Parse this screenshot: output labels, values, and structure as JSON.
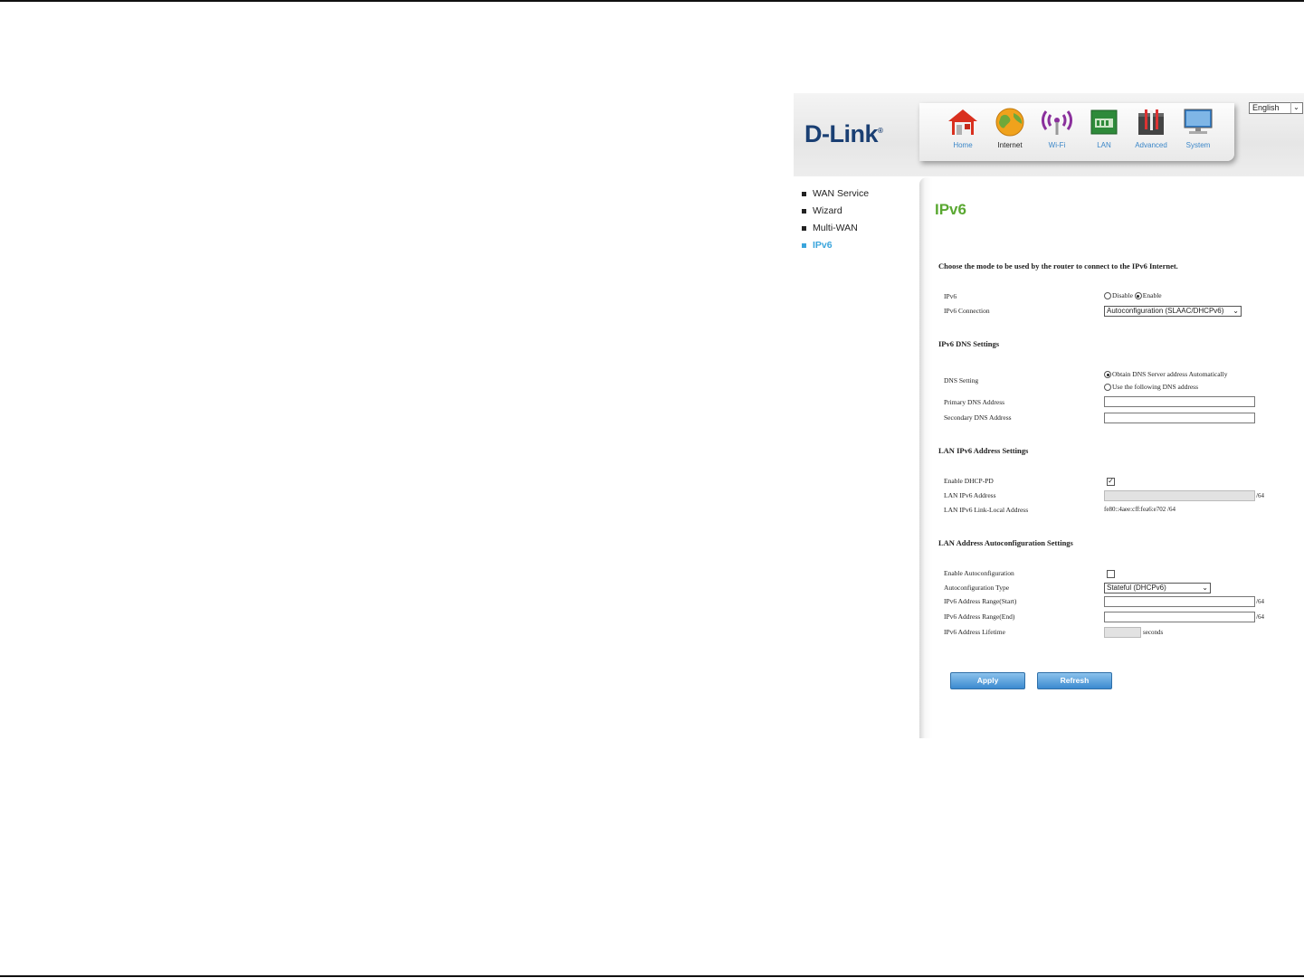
{
  "brand": {
    "logo": "D-Link",
    "trademark": "®"
  },
  "nav": [
    {
      "label": "Home",
      "icon": "home-icon"
    },
    {
      "label": "Internet",
      "icon": "globe-icon"
    },
    {
      "label": "Wi-Fi",
      "icon": "wifi-icon"
    },
    {
      "label": "LAN",
      "icon": "lan-icon"
    },
    {
      "label": "Advanced",
      "icon": "tools-icon"
    },
    {
      "label": "System",
      "icon": "monitor-icon"
    }
  ],
  "nav_active": "Internet",
  "language": {
    "selected": "English"
  },
  "sidebar": [
    {
      "label": "WAN Service"
    },
    {
      "label": "Wizard"
    },
    {
      "label": "Multi-WAN"
    },
    {
      "label": "IPv6"
    }
  ],
  "page": {
    "title": "IPv6",
    "intro": "Choose the mode to be used by the router to connect to the IPv6 Internet."
  },
  "ipv6": {
    "label": "IPv6",
    "disable_label": "Disable",
    "enable_label": "Enable",
    "selected": "Enable",
    "connection_label": "IPv6 Connection",
    "connection_value": "Autoconfiguration (SLAAC/DHCPv6)"
  },
  "dns": {
    "section_title": "IPv6 DNS Settings",
    "setting_label": "DNS Setting",
    "option_auto": "Obtain DNS Server address Automatically",
    "option_manual": "Use the following DNS address",
    "selected": "auto",
    "primary_label": "Primary DNS Address",
    "primary_value": "",
    "secondary_label": "Secondary DNS Address",
    "secondary_value": ""
  },
  "lan": {
    "section_title": "LAN IPv6 Address Settings",
    "dhcp_pd_label": "Enable DHCP-PD",
    "dhcp_pd_checked": true,
    "address_label": "LAN IPv6 Address",
    "address_value": "",
    "address_suffix": "/64",
    "link_local_label": "LAN IPv6 Link-Local Address",
    "link_local_value": "fe80::4aee:cff:fea6:e702 /64"
  },
  "autoconf": {
    "section_title": "LAN Address Autoconfiguration Settings",
    "enable_label": "Enable Autoconfiguration",
    "enable_checked": false,
    "type_label": "Autoconfiguration Type",
    "type_value": "Stateful (DHCPv6)",
    "range_start_label": "IPv6 Address Range(Start)",
    "range_start_value": "",
    "range_end_label": "IPv6 Address Range(End)",
    "range_end_value": "",
    "range_suffix": "/64",
    "lifetime_label": "IPv6 Address Lifetime",
    "lifetime_value": "",
    "lifetime_unit": "seconds"
  },
  "buttons": {
    "apply": "Apply",
    "refresh": "Refresh"
  },
  "colors": {
    "title_green": "#5aa832",
    "link_blue": "#3aa5dc",
    "logo_navy": "#1a3f73",
    "button_blue": "#3b8ad0"
  }
}
